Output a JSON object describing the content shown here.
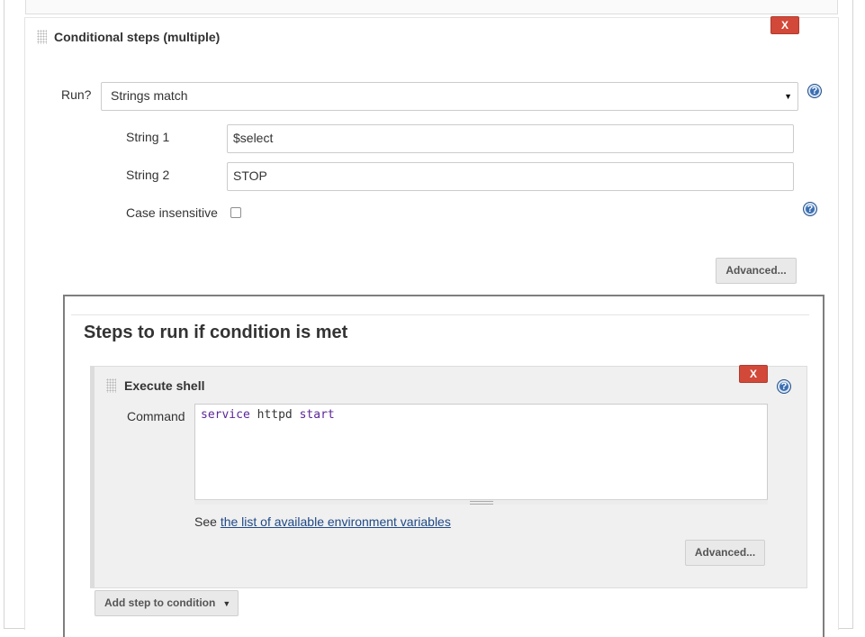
{
  "conditional": {
    "title": "Conditional steps (multiple)",
    "delete_label": "X",
    "run_label": "Run?",
    "run_value": "Strings match",
    "string1_label": "String 1",
    "string1_value": "$select",
    "string2_label": "String 2",
    "string2_value": "STOP",
    "case_label": "Case insensitive",
    "case_checked": false,
    "advanced_label": "Advanced...",
    "help_glyph": "?"
  },
  "steps": {
    "title": "Steps to run if condition is met",
    "shell": {
      "title": "Execute shell",
      "delete_label": "X",
      "command_label": "Command",
      "command_tokens": [
        "service",
        "httpd",
        "start"
      ],
      "see_prefix": "See",
      "env_link": "the list of available environment variables",
      "advanced_label": "Advanced..."
    },
    "add_step_label": "Add step to condition"
  },
  "colors": {
    "delete_red": "#d24939",
    "help_blue": "#3b6fb3",
    "link_blue": "#204a87",
    "keyword_purple": "#5c2699"
  },
  "icons": [
    "drag-handle-icon",
    "help-icon",
    "dropdown-caret-icon",
    "textarea-resize-icon"
  ]
}
